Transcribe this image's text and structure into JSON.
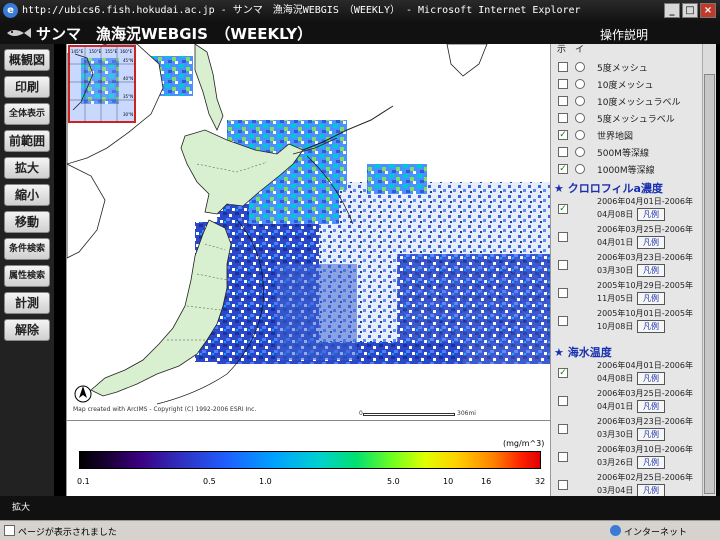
{
  "window": {
    "title": "http://ubics6.fish.hokudai.ac.jp - サンマ　漁海況WEBGIS　（WEEKLY） - Microsoft Internet Explorer",
    "controls": [
      "_",
      "□",
      "×"
    ]
  },
  "header": {
    "app_title": "サンマ　漁海況WEBGIS　（WEEKLY）",
    "manual_link": "操作説明"
  },
  "toolbar": {
    "buttons": [
      "概観図",
      "印刷",
      "全体表示",
      "前範囲",
      "拡大",
      "縮小",
      "移動",
      "条件検索",
      "属性検索",
      "計測",
      "解除"
    ]
  },
  "map": {
    "credit": "Map created with ArcIMS - Copyright (C) 1992-2006 ESRI Inc.",
    "scale_start": "0",
    "scale_label": "306mi",
    "inset_labels": [
      "145°E",
      "150°E",
      "155°E",
      "160°E",
      "45°N",
      "40°N",
      "35°N",
      "30°N"
    ]
  },
  "legend": {
    "unit": "(mg/m^3)",
    "ticks": [
      "0.1",
      "0.5",
      "1.0",
      "5.0",
      "10",
      "16",
      "32"
    ]
  },
  "layers": {
    "header_fragment": "示　イ",
    "base_layers": [
      {
        "label": "5度メッシュ",
        "checked": false
      },
      {
        "label": "10度メッシュ",
        "checked": false
      },
      {
        "label": "10度メッシュラベル",
        "checked": false
      },
      {
        "label": "5度メッシュラベル",
        "checked": false
      },
      {
        "label": "世界地図",
        "checked": true
      },
      {
        "label": "500M等深線",
        "checked": false
      },
      {
        "label": "1000M等深線",
        "checked": true
      }
    ],
    "chlorophyll": {
      "title": "★ クロロフィルa濃度",
      "items": [
        {
          "l1": "2006年04月01日-2006年",
          "l2": "04月08日",
          "btn": "凡例",
          "checked": true
        },
        {
          "l1": "2006年03月25日-2006年",
          "l2": "04月01日",
          "btn": "凡例",
          "checked": false
        },
        {
          "l1": "2006年03月23日-2006年",
          "l2": "03月30日",
          "btn": "凡例",
          "checked": false
        },
        {
          "l1": "2005年10月29日-2005年",
          "l2": "11月05日",
          "btn": "凡例",
          "checked": false
        },
        {
          "l1": "2005年10月01日-2005年",
          "l2": "10月08日",
          "btn": "凡例",
          "checked": false
        }
      ]
    },
    "sst": {
      "title": "★ 海水温度",
      "items": [
        {
          "l1": "2006年04月01日-2006年",
          "l2": "04月08日",
          "btn": "凡例",
          "checked": true
        },
        {
          "l1": "2006年03月25日-2006年",
          "l2": "04月01日",
          "btn": "凡例",
          "checked": false
        },
        {
          "l1": "2006年03月23日-2006年",
          "l2": "03月30日",
          "btn": "凡例",
          "checked": false
        },
        {
          "l1": "2006年03月10日-2006年",
          "l2": "03月26日",
          "btn": "凡例",
          "checked": false
        },
        {
          "l1": "2006年02月25日-2006年",
          "l2": "03月04日",
          "btn": "凡例",
          "checked": false
        }
      ]
    }
  },
  "bottom": {
    "zoom_label": "拡大"
  },
  "statusbar": {
    "text": "ページが表示されました",
    "zone": "インターネット"
  }
}
